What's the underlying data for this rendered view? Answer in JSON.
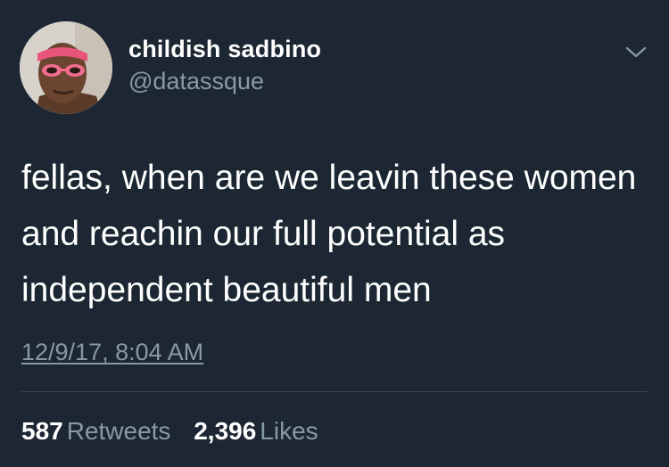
{
  "tweet": {
    "author": {
      "display_name": "childish sadbino",
      "handle": "@datassque"
    },
    "text": "fellas, when are we leavin these women and reachin our full potential as independent beautiful men",
    "timestamp": "12/9/17, 8:04 AM",
    "stats": {
      "retweets_count": "587",
      "retweets_label": "Retweets",
      "likes_count": "2,396",
      "likes_label": "Likes"
    }
  },
  "colors": {
    "background": "#1c2733",
    "primary_text": "#ffffff",
    "secondary_text": "#8899a6",
    "divider": "#38444d"
  },
  "icons": {
    "menu": "chevron-down-icon"
  }
}
